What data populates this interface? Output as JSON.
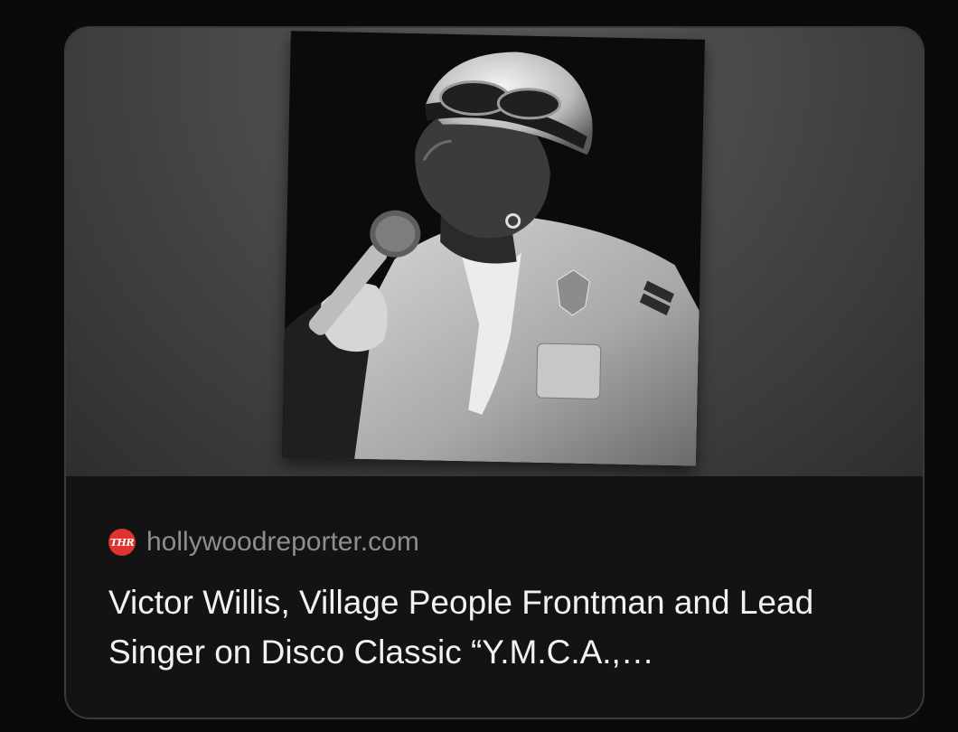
{
  "link_preview": {
    "source": {
      "logo_text": "THR",
      "logo_color": "#e0332e",
      "domain": "hollywoodreporter.com"
    },
    "headline": "Victor Willis, Village People Frontman and Lead Singer on Disco Classic “Y.M.C.A.,…",
    "image": {
      "icon": "article-photo"
    }
  }
}
